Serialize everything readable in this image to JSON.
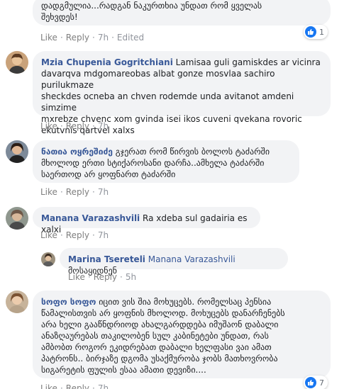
{
  "colors": {
    "name": "#385898",
    "bubble": "#f2f3f5",
    "meta": "#90949c",
    "like": "#1877f2"
  },
  "comments": [
    {
      "text_lines": [
        "დადგმულია...რადგან ნაკურთხია უნდათ რომ ყველას",
        "შეხვდეს!"
      ],
      "actions": {
        "like": "Like",
        "reply": "Reply",
        "time": "7h",
        "edited": "Edited"
      },
      "reactions": {
        "icon": "like-icon",
        "count": "1"
      }
    },
    {
      "author": "Mzia Chupenia Gogritchiani",
      "text_lines": [
        "Lamisaa guli gamiskdes ar vicinra",
        "davarqva mdgomareobas albat gonze mosvlaa sachiro purilukmaze",
        "sheckdes ocneba an chven rodemde unda avitanot amdeni simzime",
        "mxrebze chvenc xom gvinda isei ikos cuveni qvekana rovoric",
        "ekutvnis qartvel xalxs"
      ],
      "actions": {
        "like": "Like",
        "reply": "Reply",
        "time": "7h"
      }
    },
    {
      "author": "ნათია ოყრეშიძე",
      "text_lines": [
        "გჯერათ რომ წირვის ბოლოს ტაძარში",
        "მხოლოდ ერთი სტიქაროსანი დარჩა..ამხელა ტაძარში",
        "საერთოდ არ ყოფნართ ტაძარში"
      ],
      "actions": {
        "like": "Like",
        "reply": "Reply",
        "time": "7h"
      }
    },
    {
      "author": "Manana Varazashvili",
      "text_lines": [
        "Ra xdeba sul gadairia es xalxi"
      ],
      "actions": {
        "like": "Like",
        "reply": "Reply",
        "time": "7h"
      }
    },
    {
      "author": "Marina Tsereteli",
      "mention": "Manana Varazashvili",
      "text_lines": [
        "მოსაყიდნენ"
      ],
      "actions": {
        "like": "Like",
        "reply": "Reply",
        "time": "5h"
      }
    },
    {
      "author": "სოფო სოფო",
      "text_lines": [
        "იცით ვის შია მოხუცებს. რომელსაც პენსია",
        "წამალისთვის არ ყოფნის მხოლოდ. მოხუცებს დანარჩენებს",
        "არა ხელი გააწნდრიოდ ახალგარდდება იმუშაონ დაბალი",
        "ანაზღაურებას თაკილობენ სულ კაბინეტები უნდათ, რას",
        "ამბობთ როგორ ეკიდრებათ დაბალი ხელფასი ვაი ამათ",
        "პატრონს.. ბირჯაზე დგომა უსაქმურობა ჯობს მათხოვრობა",
        "სიგარეტის ფულის ესაა ამათი დევიზი...."
      ],
      "actions": {
        "like": "Like",
        "reply": "Reply",
        "time": "7h"
      },
      "reactions": {
        "icon": "like-icon",
        "count": "7"
      }
    }
  ]
}
